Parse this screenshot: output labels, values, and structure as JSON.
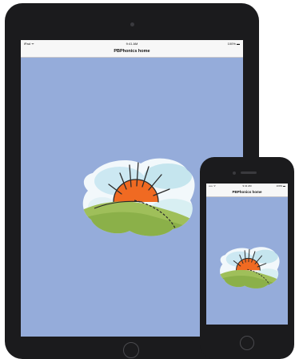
{
  "ipad": {
    "status_carrier": "iPad ᯤ",
    "status_time": "9:41 AM",
    "status_battery": "100% ▬",
    "nav_title": "PBPhonics home"
  },
  "iphone": {
    "status_carrier": "••••• ᯤ",
    "status_time": "9:41 AM",
    "status_battery": "100% ▬",
    "nav_title": "PBPhonics home"
  },
  "colors": {
    "screen_background": "#95acda",
    "device_frame": "#1b1b1d",
    "sun": "#f06a22",
    "hill": "#9fbf5a",
    "cloud": "#f2f8fb"
  },
  "logo": {
    "name": "watercolor-sunrise-logo"
  }
}
